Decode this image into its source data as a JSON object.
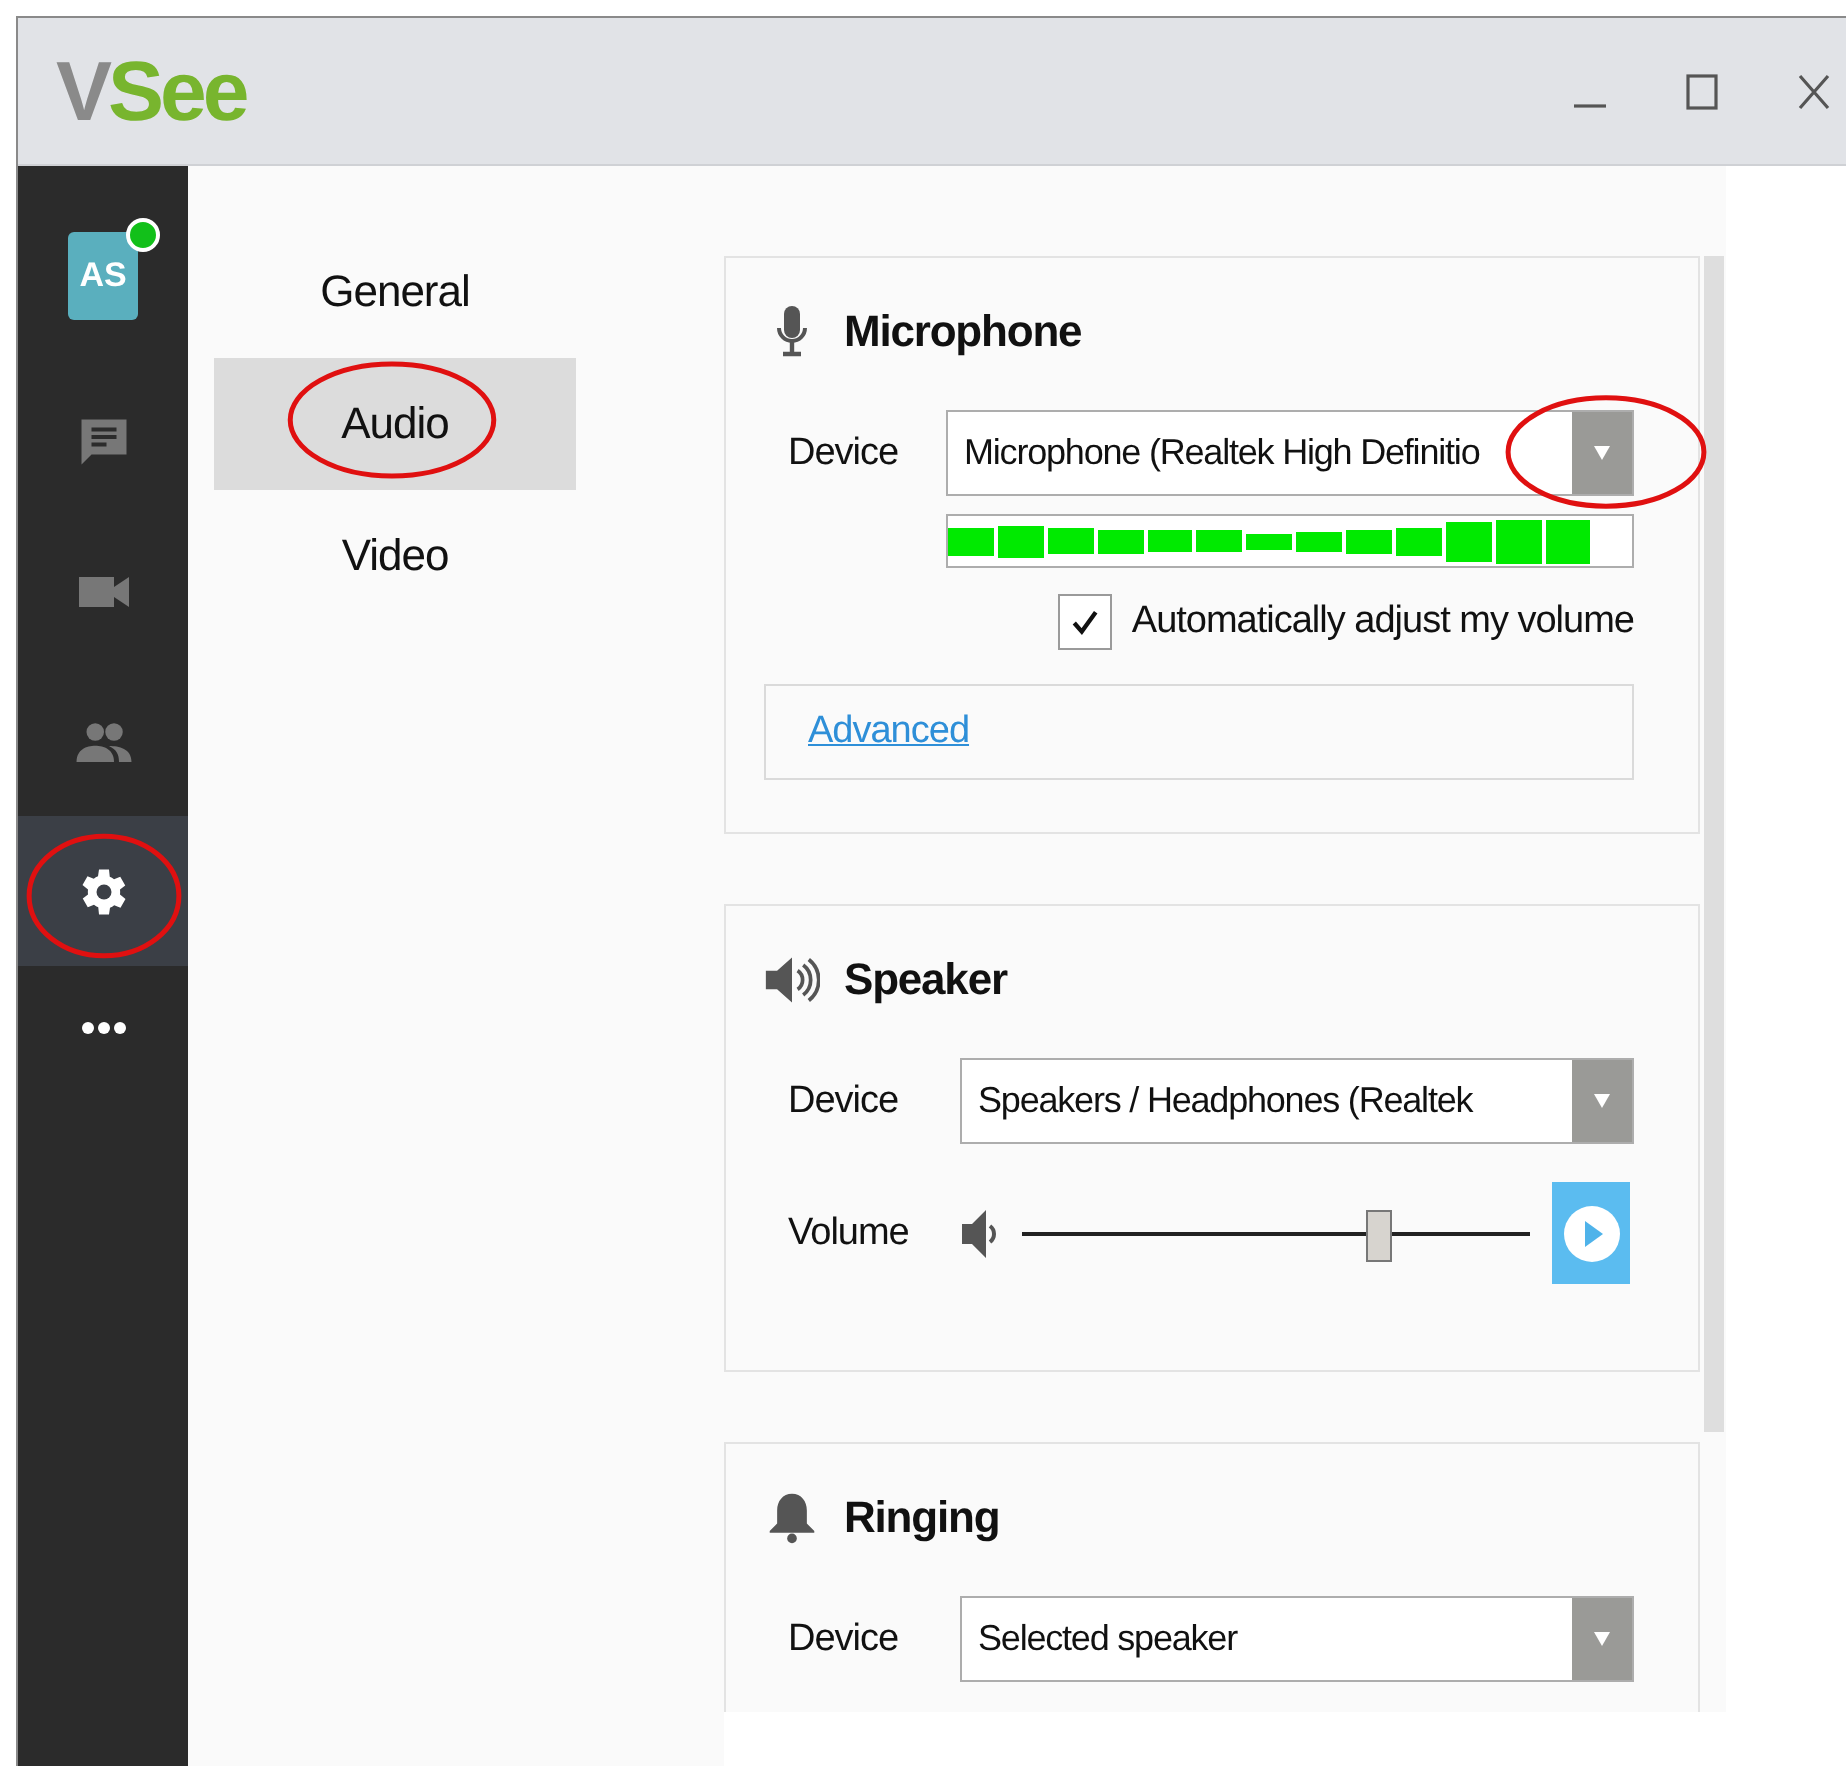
{
  "window": {
    "logo": "VSee"
  },
  "nav": [
    {
      "kind": "avatar",
      "initials": "AS",
      "online": true,
      "selected": false,
      "circled": false
    },
    {
      "kind": "chat",
      "selected": false,
      "circled": false
    },
    {
      "kind": "video",
      "selected": false,
      "circled": false
    },
    {
      "kind": "contacts",
      "selected": false,
      "circled": false
    },
    {
      "kind": "settings",
      "selected": true,
      "circled": true
    },
    {
      "kind": "more",
      "selected": false,
      "circled": false
    }
  ],
  "categories": [
    {
      "label": "General",
      "selected": false,
      "circled": false
    },
    {
      "label": "Audio",
      "selected": true,
      "circled": true
    },
    {
      "label": "Video",
      "selected": false,
      "circled": false
    }
  ],
  "sections": [
    {
      "kind": "microphone",
      "title": "Microphone",
      "rows": [
        {
          "kind": "dropdown",
          "label": "Device",
          "value": "Microphone (Realtek High Definitio",
          "circled": true
        },
        {
          "kind": "meter"
        },
        {
          "kind": "checkbox",
          "label": "Automatically adjust my volume",
          "checked": true
        },
        {
          "kind": "link",
          "label": "Advanced"
        }
      ]
    },
    {
      "kind": "speaker",
      "title": "Speaker",
      "rows": [
        {
          "kind": "dropdown",
          "label": "Device",
          "value": "Speakers / Headphones (Realtek",
          "circled": false
        },
        {
          "kind": "slider",
          "label": "Volume",
          "level": 0.7
        }
      ]
    },
    {
      "kind": "ringing",
      "title": "Ringing",
      "rows": [
        {
          "kind": "dropdown",
          "label": "Device",
          "value": "Selected speaker",
          "circled": false
        }
      ]
    }
  ]
}
